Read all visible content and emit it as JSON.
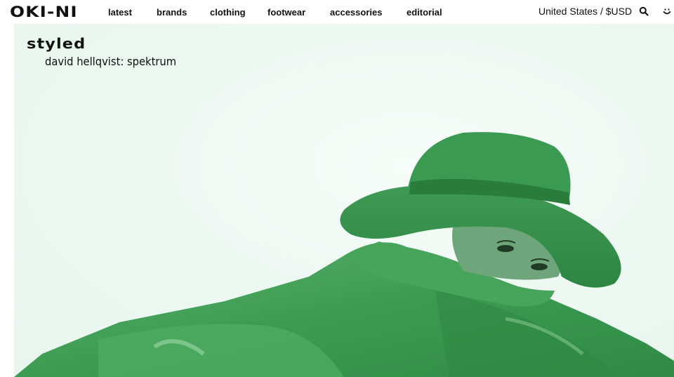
{
  "brand": {
    "logo_text": "OKI-NI"
  },
  "nav": {
    "items": [
      {
        "label": "latest"
      },
      {
        "label": "brands"
      },
      {
        "label": "clothing"
      },
      {
        "label": "footwear"
      },
      {
        "label": "accessories"
      },
      {
        "label": "editorial"
      }
    ]
  },
  "utility": {
    "region_label": "United States / $USD",
    "search_icon": "search-icon",
    "account_icon": "smiley-icon"
  },
  "hero": {
    "kicker": "styled",
    "title": "david hellqvist: spektrum",
    "image_description_colors": {
      "background": "#eef8f3",
      "garment": "#3c9b52"
    }
  }
}
